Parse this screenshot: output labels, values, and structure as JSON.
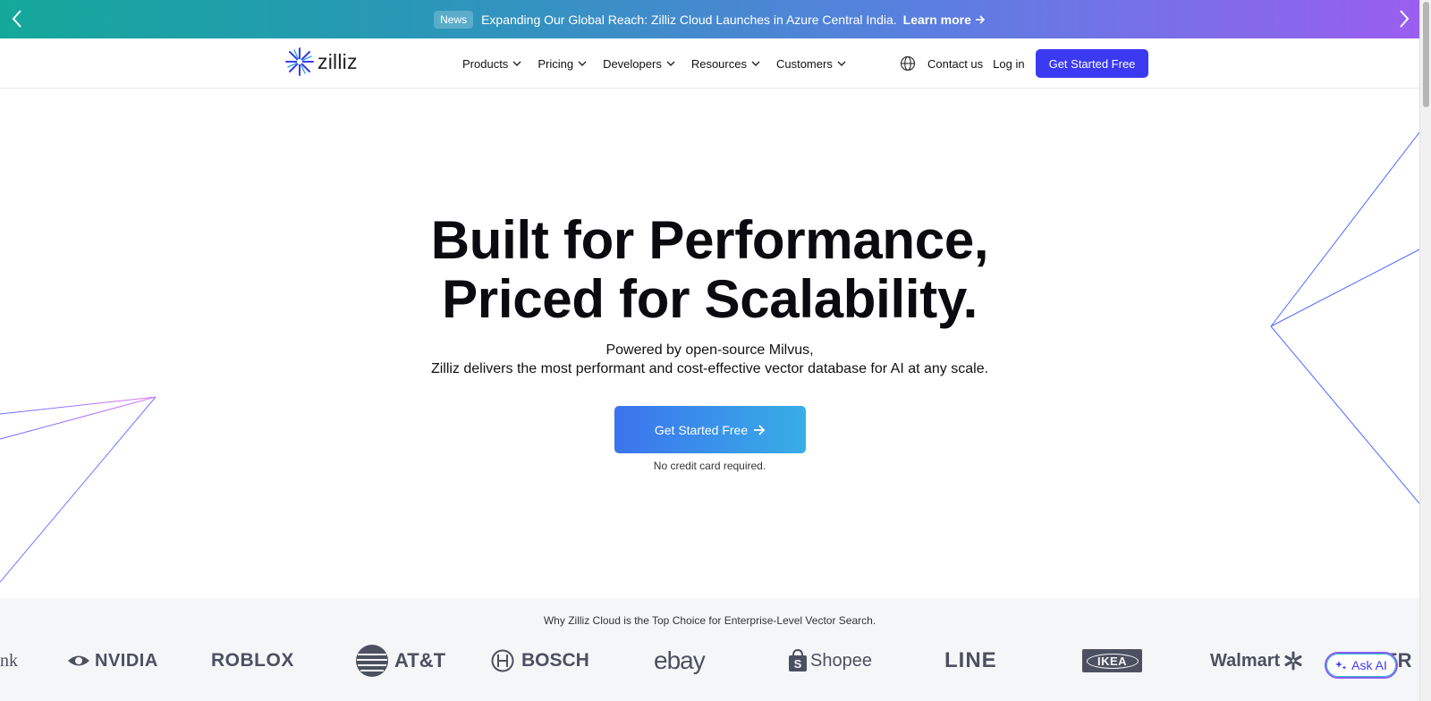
{
  "announcement": {
    "badge": "News",
    "message": "Expanding Our Global Reach: Zilliz Cloud Launches in Azure Central India.",
    "link_label": "Learn more"
  },
  "nav": {
    "logo_text": "zilliz",
    "menu": [
      {
        "label": "Products"
      },
      {
        "label": "Pricing"
      },
      {
        "label": "Developers"
      },
      {
        "label": "Resources"
      },
      {
        "label": "Customers"
      }
    ],
    "contact_label": "Contact us",
    "login_label": "Log in",
    "cta_label": "Get Started Free"
  },
  "hero": {
    "title_line1": "Built for Performance,",
    "title_line2": "Priced for Scalability.",
    "subtitle_line1": "Powered by open-source Milvus,",
    "subtitle_line2": "Zilliz delivers the most performant and cost-effective vector database for AI at any scale.",
    "cta_label": "Get Started Free",
    "note": "No credit card required."
  },
  "logos": {
    "caption": "Why Zilliz Cloud is the Top Choice for Enterprise-Level Vector Search.",
    "brands": [
      "nk",
      "NVIDIA",
      "ROBLOX",
      "AT&T",
      "BOSCH",
      "ebay",
      "Shopee",
      "LINE",
      "IKEA",
      "Walmart",
      "ER"
    ]
  },
  "ask_ai": {
    "label": "Ask AI"
  },
  "colors": {
    "primary": "#3b3af2",
    "banner_start": "#14a89a",
    "banner_end": "#9a5ef0",
    "hero_cta_start": "#3c73ee",
    "hero_cta_end": "#38aee6"
  }
}
